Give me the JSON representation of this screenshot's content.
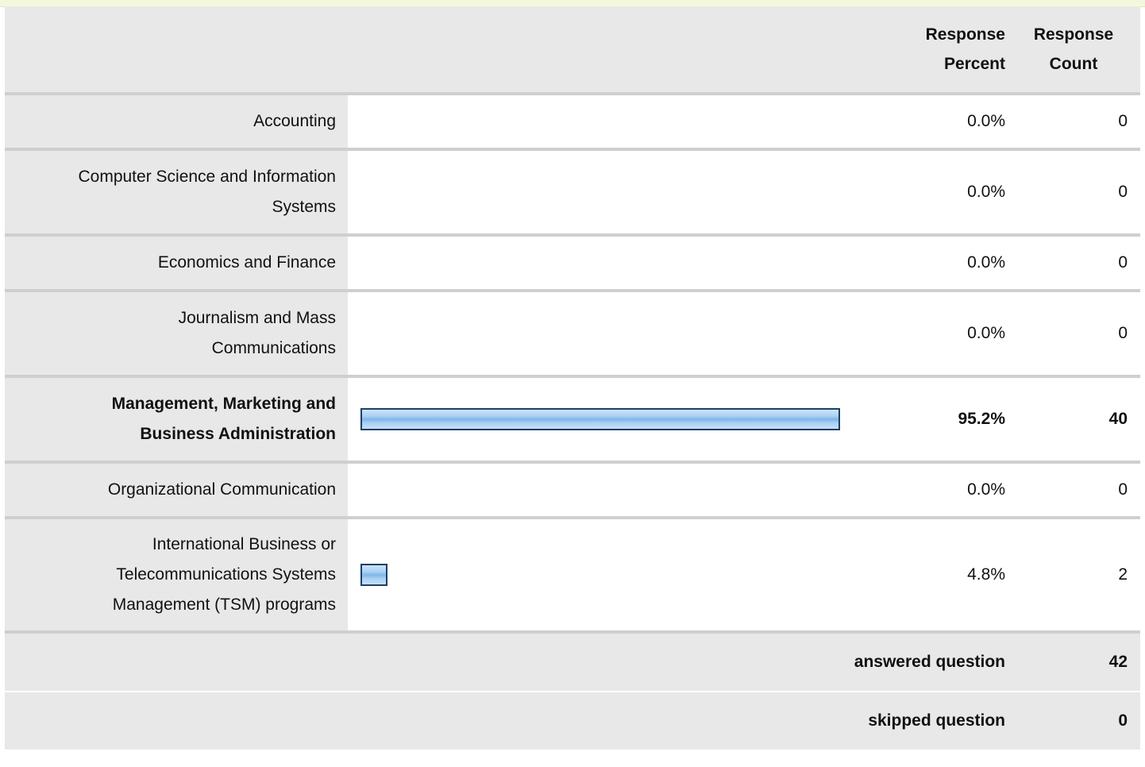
{
  "table": {
    "headers": {
      "percent_line1": "Response",
      "percent_line2": "Percent",
      "count_line1": "Response",
      "count_line2": "Count"
    },
    "rows": [
      {
        "label_lines": [
          "Accounting"
        ],
        "percent": "0.0%",
        "count": "0",
        "fraction": 0.0,
        "emphasis": false
      },
      {
        "label_lines": [
          "Computer Science and Information",
          "Systems"
        ],
        "percent": "0.0%",
        "count": "0",
        "fraction": 0.0,
        "emphasis": false
      },
      {
        "label_lines": [
          "Economics and Finance"
        ],
        "percent": "0.0%",
        "count": "0",
        "fraction": 0.0,
        "emphasis": false
      },
      {
        "label_lines": [
          "Journalism and Mass",
          "Communications"
        ],
        "percent": "0.0%",
        "count": "0",
        "fraction": 0.0,
        "emphasis": false
      },
      {
        "label_lines": [
          "Management, Marketing and",
          "Business Administration"
        ],
        "percent": "95.2%",
        "count": "40",
        "fraction": 0.952,
        "emphasis": true
      },
      {
        "label_lines": [
          "Organizational Communication"
        ],
        "percent": "0.0%",
        "count": "0",
        "fraction": 0.0,
        "emphasis": false
      },
      {
        "label_lines": [
          "International Business or",
          "Telecommunications Systems",
          "Management (TSM) programs"
        ],
        "percent": "4.8%",
        "count": "2",
        "fraction": 0.048,
        "emphasis": false
      }
    ],
    "footer": {
      "answered_label": "answered question",
      "answered_value": "42",
      "skipped_label": "skipped question",
      "skipped_value": "0"
    }
  },
  "colors": {
    "bar_fill": "#a8cff4",
    "bar_border": "#1f3f66",
    "label_bg": "#e8e8e8",
    "top_strip": "#f3f8dc"
  }
}
